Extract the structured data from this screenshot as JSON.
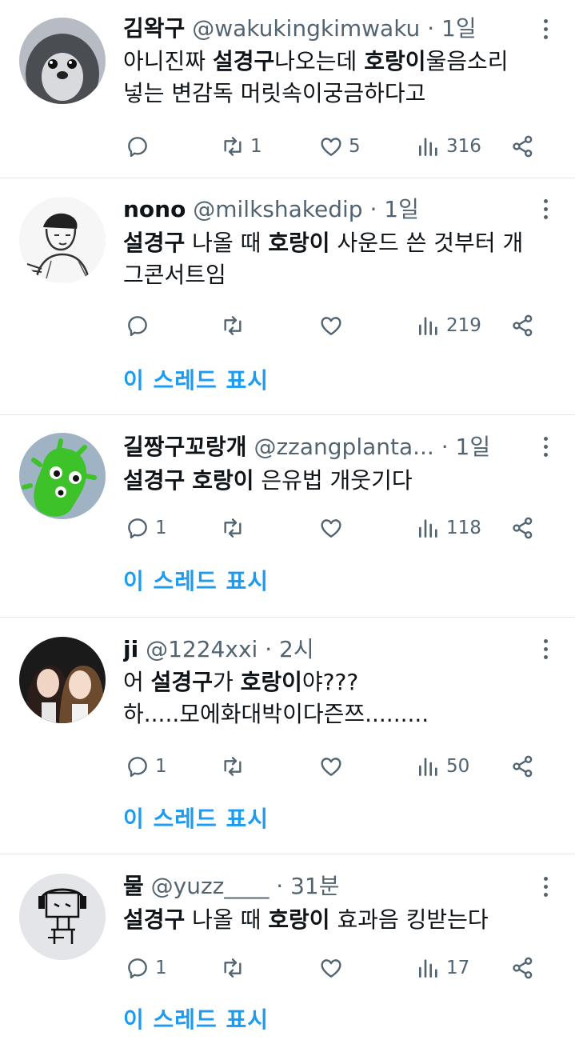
{
  "tweets": [
    {
      "name": "김왁구",
      "handle": "@wakukingkimwaku",
      "time": "· 1일",
      "lines": [
        [
          {
            "t": "아니진짜 "
          },
          {
            "t": "설경구",
            "b": true
          },
          {
            "t": "나오는데 "
          },
          {
            "t": "호랑이",
            "b": true
          },
          {
            "t": "울음소리"
          }
        ],
        [
          {
            "t": "넣는 변감독 머릿속이궁금하다고"
          }
        ]
      ],
      "replies": "",
      "retweets": "1",
      "likes": "5",
      "views": "316",
      "show_thread": ""
    },
    {
      "name": "nono",
      "handle": "@milkshakedip",
      "time": "· 1일",
      "lines": [
        [
          {
            "t": "설경구",
            "b": true
          },
          {
            "t": " 나올 때 "
          },
          {
            "t": "호랑이",
            "b": true
          },
          {
            "t": " 사운드 쓴 것부터 개"
          }
        ],
        [
          {
            "t": "그콘서트임"
          }
        ]
      ],
      "replies": "",
      "retweets": "",
      "likes": "",
      "views": "219",
      "show_thread": "이 스레드 표시"
    },
    {
      "name": "길짱구꼬랑개",
      "handle": "@zzangplanta...",
      "time": "· 1일",
      "lines": [
        [
          {
            "t": "설경구",
            "b": true
          },
          {
            "t": " "
          },
          {
            "t": "호랑이",
            "b": true
          },
          {
            "t": " 은유법 개웃기다"
          }
        ]
      ],
      "replies": "1",
      "retweets": "",
      "likes": "",
      "views": "118",
      "show_thread": "이 스레드 표시"
    },
    {
      "name": "ji",
      "handle": "@1224xxi",
      "time": "· 2시",
      "lines": [
        [
          {
            "t": "어 "
          },
          {
            "t": "설경구",
            "b": true
          },
          {
            "t": "가 "
          },
          {
            "t": "호랑이",
            "b": true
          },
          {
            "t": "야???"
          }
        ],
        [
          {
            "t": "하.....모에화대박이다즌쯔........."
          }
        ]
      ],
      "replies": "1",
      "retweets": "",
      "likes": "",
      "views": "50",
      "show_thread": "이 스레드 표시"
    },
    {
      "name": "물",
      "handle": "@yuzz____",
      "time": "· 31분",
      "lines": [
        [
          {
            "t": "설경구",
            "b": true
          },
          {
            "t": " 나올 때 "
          },
          {
            "t": "호랑이",
            "b": true
          },
          {
            "t": " 효과음 킹받는다"
          }
        ]
      ],
      "replies": "1",
      "retweets": "",
      "likes": "",
      "views": "17",
      "show_thread": "이 스레드 표시"
    }
  ]
}
